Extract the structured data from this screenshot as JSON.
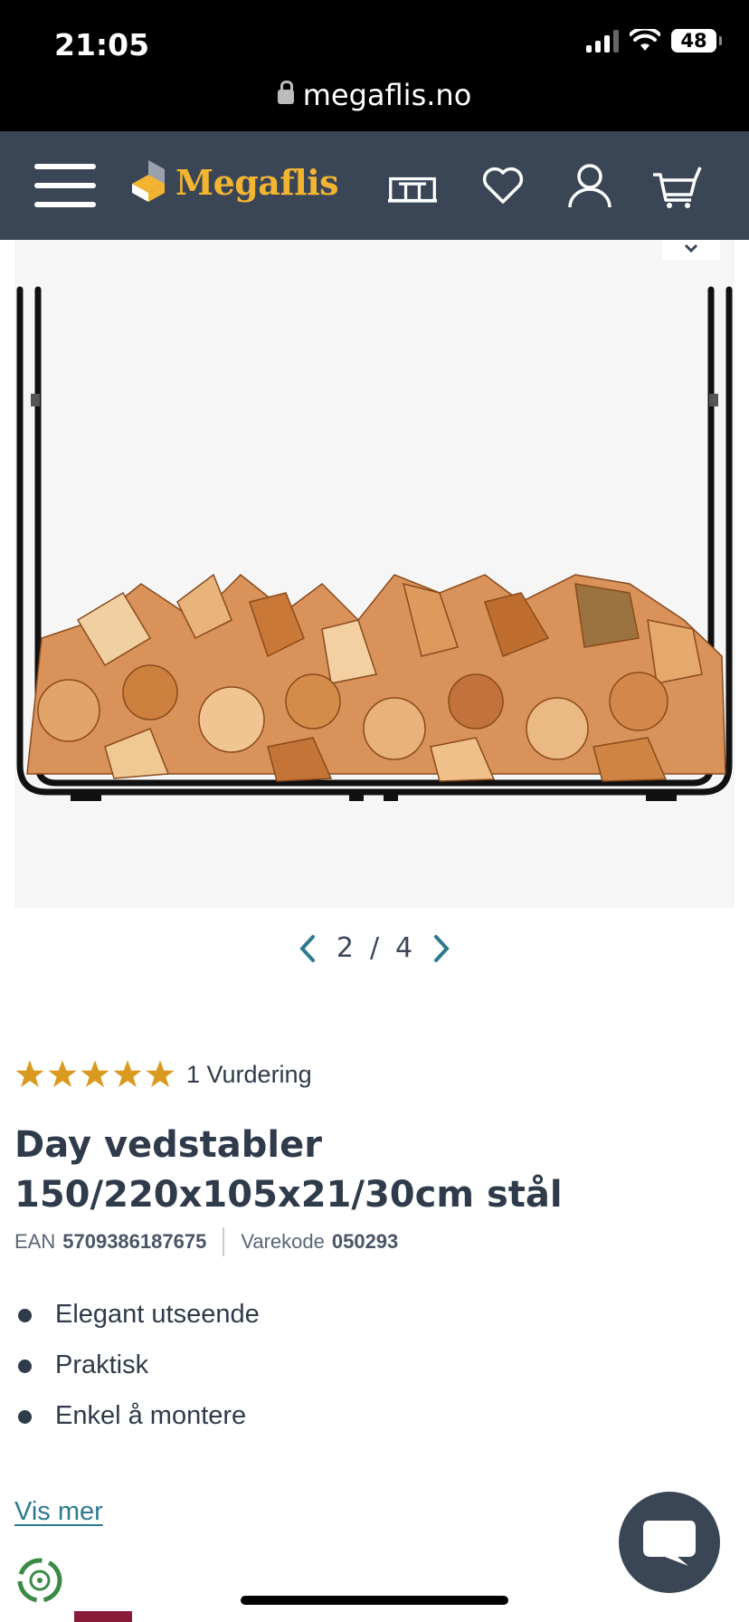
{
  "status_bar": {
    "time": "21:05",
    "battery": "48"
  },
  "browser": {
    "url": "megaflis.no"
  },
  "header": {
    "brand": "Megaflis",
    "icons": [
      "menu-icon",
      "store-icon",
      "heart-icon",
      "user-icon",
      "cart-icon"
    ],
    "colors": {
      "header_bg": "#3a4656",
      "brand": "#f3b531"
    }
  },
  "gallery": {
    "current": "2",
    "separator": "/",
    "total": "4"
  },
  "product": {
    "rating_stars": 5,
    "rating_text": "1 Vurdering",
    "title": "Day vedstabler 150/220x105x21/30cm stål",
    "ean_label": "EAN",
    "ean_value": "5709386187675",
    "sku_label": "Varekode",
    "sku_value": "050293",
    "features": [
      "Elegant utseende",
      "Praktisk",
      "Enkel å montere"
    ],
    "show_more": "Vis mer"
  },
  "colors": {
    "star": "#d99a1f",
    "link": "#2d7a8f",
    "text": "#2f3b4a"
  }
}
